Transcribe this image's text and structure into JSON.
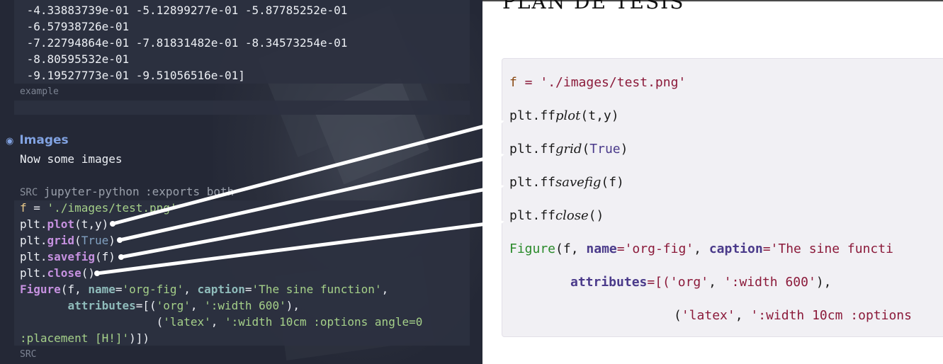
{
  "editor": {
    "output_lines": [
      " -4.33883739e-01 -5.12899277e-01 -5.87785252e-01",
      " -6.57938726e-01",
      " -7.22794864e-01 -7.81831482e-01 -8.34573254e-01",
      " -8.80595532e-01",
      " -9.19527773e-01 -9.51056516e-01]"
    ],
    "example_label": "example",
    "heading_bullet": "◉",
    "heading": "Images",
    "paragraph": "Now some images",
    "src_header": {
      "tag": "SRC",
      "lang": "jupyter-python",
      "args": ":exports both"
    },
    "code": {
      "l1_var": "f",
      "l1_eq": " = ",
      "l1_str": "'./images/test.png'",
      "l2_obj": "plt.",
      "l2_fn": "plot",
      "l2_args": "(t,y)",
      "l3_obj": "plt.",
      "l3_fn": "grid",
      "l3_open": "(",
      "l3_true": "True",
      "l3_close": ")",
      "l4_obj": "plt.",
      "l4_fn": "savefig",
      "l4_args": "(f)",
      "l5_obj": "plt.",
      "l5_fn": "close",
      "l5_args": "()",
      "l6_fn": "Figure",
      "l6_a": "(f, ",
      "l6_name_kw": "name",
      "l6_eq1": "=",
      "l6_name_val": "'org-fig'",
      "l6_comma": ", ",
      "l6_cap_kw": "caption",
      "l6_eq2": "=",
      "l6_cap_val": "'The sine function'",
      "l6_end": ",",
      "l7_indent": "       ",
      "l7_kw": "attributes",
      "l7_a": "=[(",
      "l7_s1": "'org'",
      "l7_c": ", ",
      "l7_s2": "':width 600'",
      "l7_end": "),",
      "l8_indent": "                    (",
      "l8_s1": "'latex'",
      "l8_c": ", ",
      "l8_s2": "':width 10cm :options angle=0",
      "l9_s": ":placement [H!]'",
      "l9_end": ")])"
    },
    "src_footer": "SRC"
  },
  "document": {
    "title": "PLAN DE TESIS",
    "lines": {
      "d1_var": "f",
      "d1_eq": " = ",
      "d1_str": "'./images/test.png'",
      "d2_obj": "plt.ff",
      "d2_fn": "plot",
      "d2_args": "(t,y)",
      "d3_obj": "plt.ff",
      "d3_fn": "grid",
      "d3_open": "(",
      "d3_true": "True",
      "d3_close": ")",
      "d4_obj": "plt.ff",
      "d4_fn": "savefig",
      "d4_args": "(f)",
      "d5_obj": "plt.ff",
      "d5_fn": "close",
      "d5_args": "()",
      "d6_fn": "Figure",
      "d6_a": "(f, ",
      "d6_name_kw": "name",
      "d6_eq1": "=",
      "d6_name_val": "'org-fig'",
      "d6_comma": ", ",
      "d6_cap_kw": "caption",
      "d6_eq2": "=",
      "d6_cap_val": "'The sine functi",
      "d7_kw": "attributes",
      "d7_a": "=[(",
      "d7_s1": "'org'",
      "d7_c": ", ",
      "d7_s2": "':width 600'",
      "d7_end": "),",
      "d8_open": "(",
      "d8_s1": "'latex'",
      "d8_c": ", ",
      "d8_s2": "':width 10cm :options"
    }
  },
  "colors": {
    "editor_bg": "#242836",
    "keyword": "#c691e0",
    "string": "#a5d089",
    "heading": "#81a2e1",
    "doc_bg": "#f1f0f4"
  }
}
